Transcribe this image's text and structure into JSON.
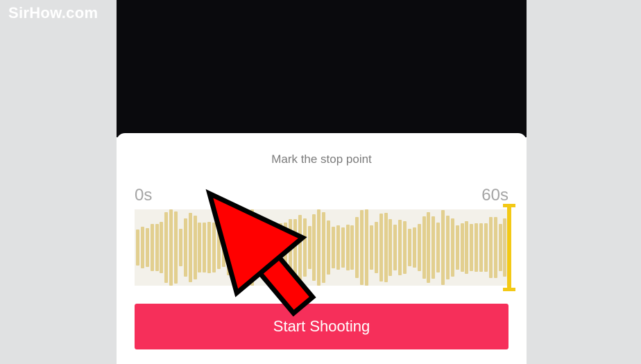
{
  "watermark": "SirHow.com",
  "panel": {
    "title": "Mark the stop point",
    "time_start": "0s",
    "time_end": "60s"
  },
  "button": {
    "start_label": "Start Shooting"
  }
}
